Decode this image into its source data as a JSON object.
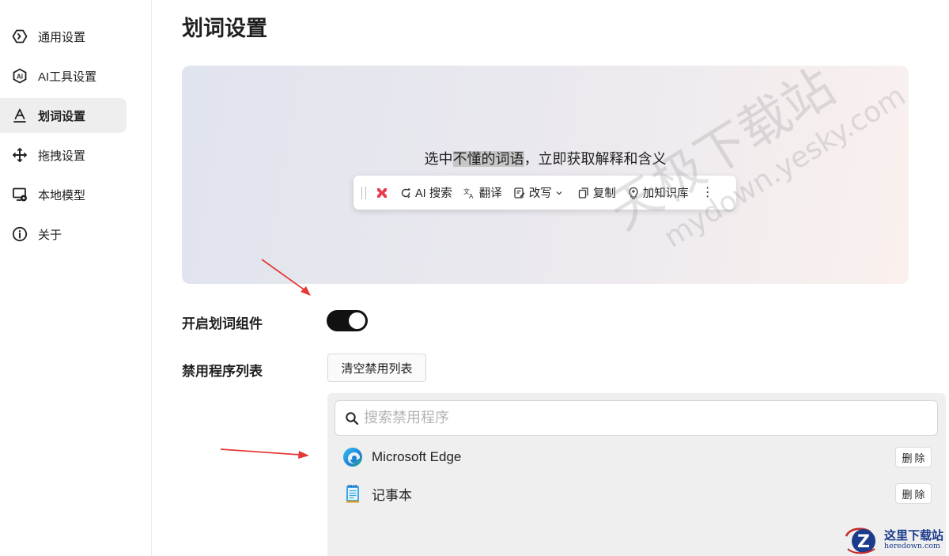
{
  "sidebar": {
    "items": [
      {
        "label": "通用设置",
        "icon": "general-settings-icon",
        "active": false
      },
      {
        "label": "AI工具设置",
        "icon": "ai-tool-icon",
        "active": false
      },
      {
        "label": "划词设置",
        "icon": "underline-a-icon",
        "active": true
      },
      {
        "label": "拖拽设置",
        "icon": "drag-move-icon",
        "active": false
      },
      {
        "label": "本地模型",
        "icon": "local-model-icon",
        "active": false
      },
      {
        "label": "关于",
        "icon": "info-icon",
        "active": false
      }
    ]
  },
  "main": {
    "title": "划词设置",
    "preview": {
      "text_before": "选中",
      "text_highlight": "不懂的词语",
      "text_after": "，立即获取解释和含义",
      "toolbar": {
        "ai_search": "AI 搜索",
        "translate": "翻译",
        "rewrite": "改写",
        "copy": "复制",
        "add_kb": "加知识库"
      }
    },
    "toggle_label": "开启划词组件",
    "toggle_on": true,
    "disabled_label": "禁用程序列表",
    "clear_button": "清空禁用列表",
    "search_placeholder": "搜索禁用程序",
    "apps": [
      {
        "name": "Microsoft Edge",
        "icon": "edge-icon",
        "delete": "删除"
      },
      {
        "name": "记事本",
        "icon": "notepad-icon",
        "delete": "删除"
      }
    ]
  },
  "watermark": {
    "cn": "天极下载站",
    "en": "mydown.yesky.com"
  },
  "corner_logo": {
    "cn": "这里下载站",
    "en": "heredown.com"
  },
  "colors": {
    "accent": "#111111",
    "arrow": "#e53935",
    "toggle_knob": "#ffffff"
  }
}
